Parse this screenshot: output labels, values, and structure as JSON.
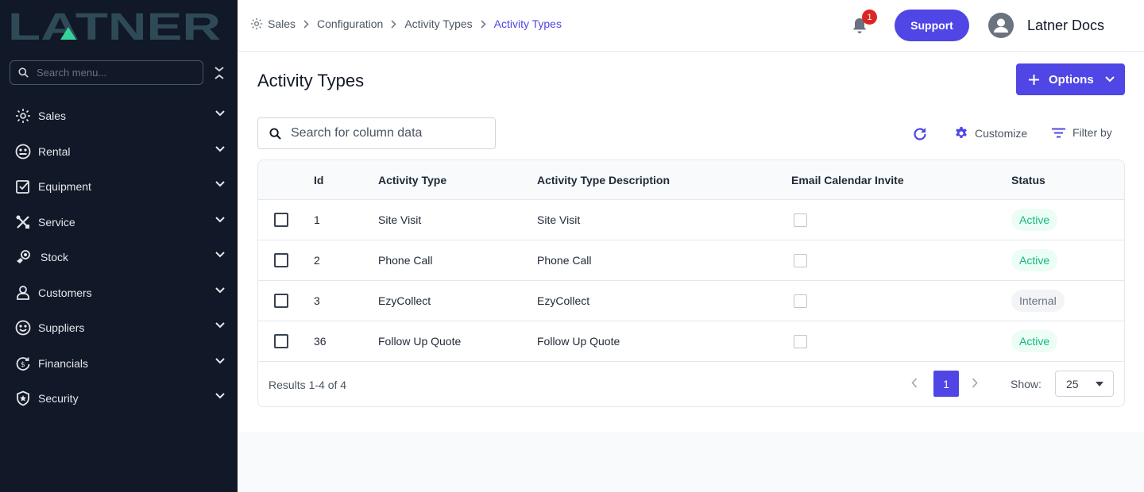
{
  "sidebar": {
    "logo_text": "LATNER",
    "search_placeholder": "Search menu...",
    "items": [
      {
        "label": "Sales",
        "icon": "sales-icon"
      },
      {
        "label": "Rental",
        "icon": "rental-icon"
      },
      {
        "label": "Equipment",
        "icon": "equipment-icon"
      },
      {
        "label": "Service",
        "icon": "service-icon"
      },
      {
        "label": "Stock",
        "icon": "stock-icon"
      },
      {
        "label": "Customers",
        "icon": "customers-icon"
      },
      {
        "label": "Suppliers",
        "icon": "suppliers-icon"
      },
      {
        "label": "Financials",
        "icon": "financials-icon"
      },
      {
        "label": "Security",
        "icon": "security-icon"
      }
    ]
  },
  "topbar": {
    "breadcrumb": [
      "Sales",
      "Configuration",
      "Activity Types",
      "Activity Types"
    ],
    "notification_count": "1",
    "support_label": "Support",
    "user_name": "Latner Docs"
  },
  "page": {
    "title": "Activity Types",
    "options_label": "Options",
    "search_placeholder": "Search for column data",
    "customize_label": "Customize",
    "filter_label": "Filter by"
  },
  "table": {
    "columns": [
      "Id",
      "Activity Type",
      "Activity Type Description",
      "Email Calendar Invite",
      "Status"
    ],
    "rows": [
      {
        "id": "1",
        "type": "Site Visit",
        "description": "Site Visit",
        "email_invite": false,
        "status": "Active"
      },
      {
        "id": "2",
        "type": "Phone Call",
        "description": "Phone Call",
        "email_invite": false,
        "status": "Active"
      },
      {
        "id": "3",
        "type": "EzyCollect",
        "description": "EzyCollect",
        "email_invite": false,
        "status": "Internal"
      },
      {
        "id": "36",
        "type": "Follow Up Quote",
        "description": "Follow Up Quote",
        "email_invite": false,
        "status": "Active"
      }
    ],
    "results_text": "Results 1-4 of 4",
    "current_page": "1",
    "show_label": "Show:",
    "page_size": "25"
  },
  "colors": {
    "sidebar_bg": "#111827",
    "accent": "#4f46e5",
    "logo": "#2f4a57",
    "logo_triangle": "#34d399",
    "active_status": "#10b981",
    "notification": "#dc2626"
  }
}
